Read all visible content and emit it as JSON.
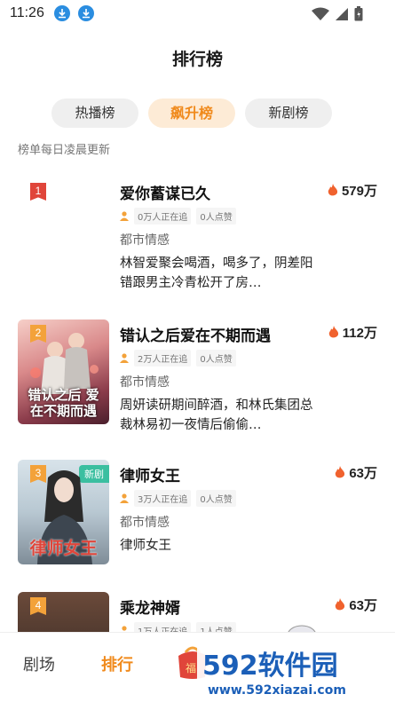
{
  "status": {
    "time": "11:26"
  },
  "header": {
    "title": "排行榜"
  },
  "tabs": [
    {
      "label": "热播榜"
    },
    {
      "label": "飙升榜"
    },
    {
      "label": "新剧榜"
    }
  ],
  "subtitle": "榜单每日凌晨更新",
  "items": [
    {
      "rank": "1",
      "title": "爱你蓄谋已久",
      "heat": "579万",
      "watching": "0万人正在追",
      "likes": "0人点赞",
      "genre": "都市情感",
      "desc": "林智爱聚会喝酒，喝多了，阴差阳错跟男主冷青松开了房…",
      "rank_color": "#e0453a"
    },
    {
      "rank": "2",
      "title": "错认之后爱在不期而遇",
      "heat": "112万",
      "watching": "2万人正在追",
      "likes": "0人点赞",
      "genre": "都市情感",
      "desc": "周妍读研期间醉酒，和林氏集团总裁林易初一夜情后偷偷…",
      "poster_text": "错认之后 爱在不期而遇",
      "rank_color": "#f3a23a"
    },
    {
      "rank": "3",
      "title": "律师女王",
      "heat": "63万",
      "watching": "3万人正在追",
      "likes": "0人点赞",
      "genre": "都市情感",
      "desc": "律师女王",
      "badge": "新剧",
      "poster_text": "律师女王",
      "rank_color": "#f3a23a"
    },
    {
      "rank": "4",
      "title": "乘龙神婿",
      "heat": "63万",
      "watching": "1万人正在追",
      "likes": "1人点赞",
      "rank_color": "#f3a23a"
    }
  ],
  "bottom_nav": [
    {
      "label": "剧场"
    },
    {
      "label": "排行"
    },
    {
      "label": "福"
    }
  ],
  "watermark": {
    "brand": "592软件园",
    "url": "www.592xiazai.com"
  },
  "colors": {
    "accent": "#f08a1c",
    "tab_active_bg": "#fdebd6",
    "fire": "#f0622e"
  }
}
